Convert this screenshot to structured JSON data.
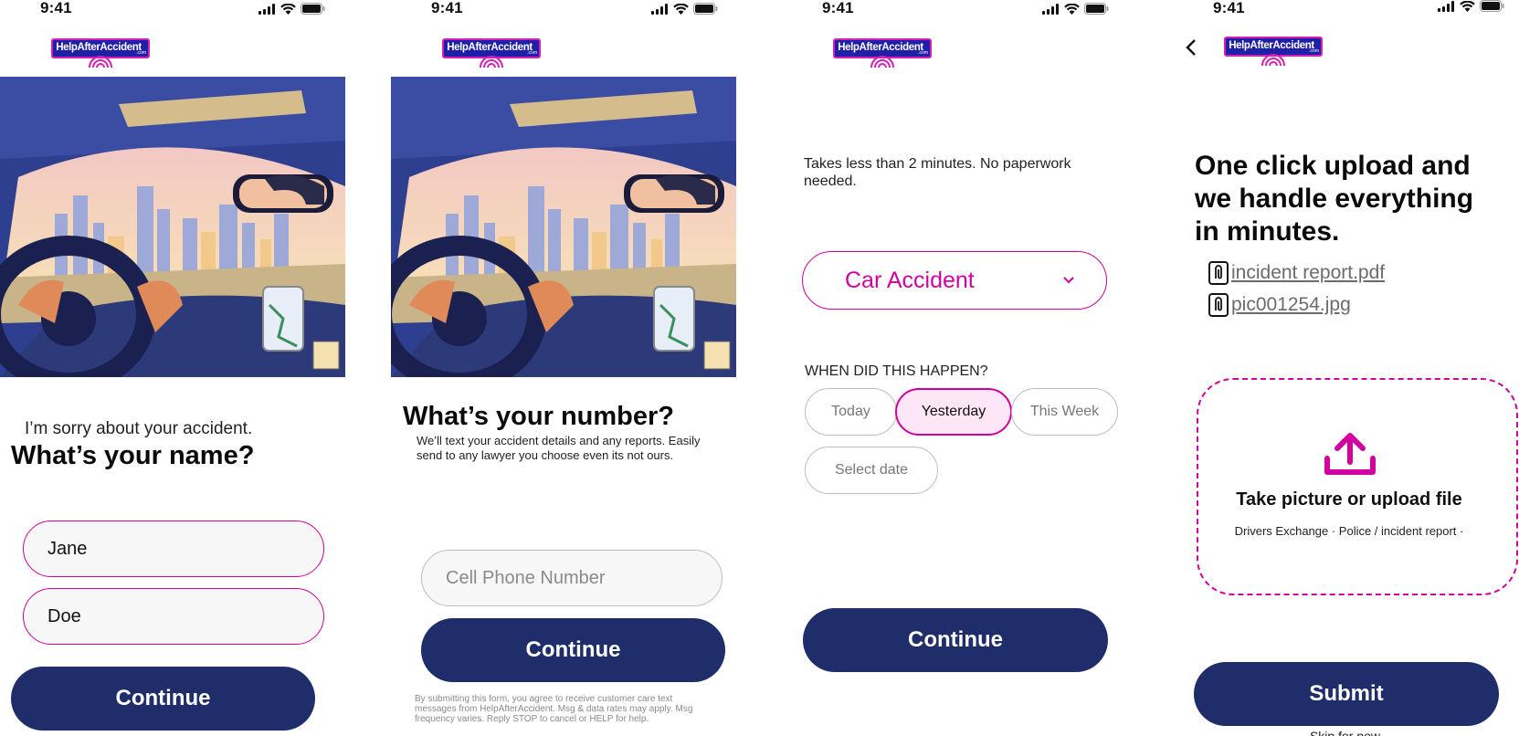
{
  "status_bar": {
    "time": "9:41"
  },
  "brand": {
    "name": "HelpAfterAccident",
    "suffix": ".com"
  },
  "colors": {
    "primary": "#1f2d6b",
    "accent": "#d1009e",
    "accent_light": "#fde6f5",
    "logo_blue": "#1f1fa8"
  },
  "screen1": {
    "subtitle": "I’m sorry about your accident.",
    "title": "What’s your name?",
    "first_name": "Jane",
    "last_name": "Doe",
    "continue": "Continue"
  },
  "screen2": {
    "title": "What’s your number?",
    "description": "We’ll text your accident details and any reports. Easily send to any lawyer you choose even its not ours.",
    "phone_placeholder": "Cell Phone Number",
    "continue": "Continue",
    "disclaimer": "By submitting this form, you agree to receive customer care text messages from HelpAfterAccident. Msg & data rates may apply. Msg frequency varies. Reply STOP to cancel or HELP for help."
  },
  "screen3": {
    "intro": "Takes less than 2 minutes. No paperwork needed.",
    "accident_type": "Car Accident",
    "when_label": "WHEN DID THIS HAPPEN?",
    "options": [
      "Today",
      "Yesterday",
      "This Week",
      "Select date"
    ],
    "selected_option": "Yesterday",
    "continue": "Continue"
  },
  "screen4": {
    "title": "One click upload and we handle everything in minutes.",
    "files": [
      "incident report.pdf",
      "pic001254.jpg"
    ],
    "upload_title": "Take picture or upload file",
    "upload_hint": "Drivers Exchange · Police / incident report ·",
    "submit": "Submit",
    "skip": "Skip for now"
  }
}
